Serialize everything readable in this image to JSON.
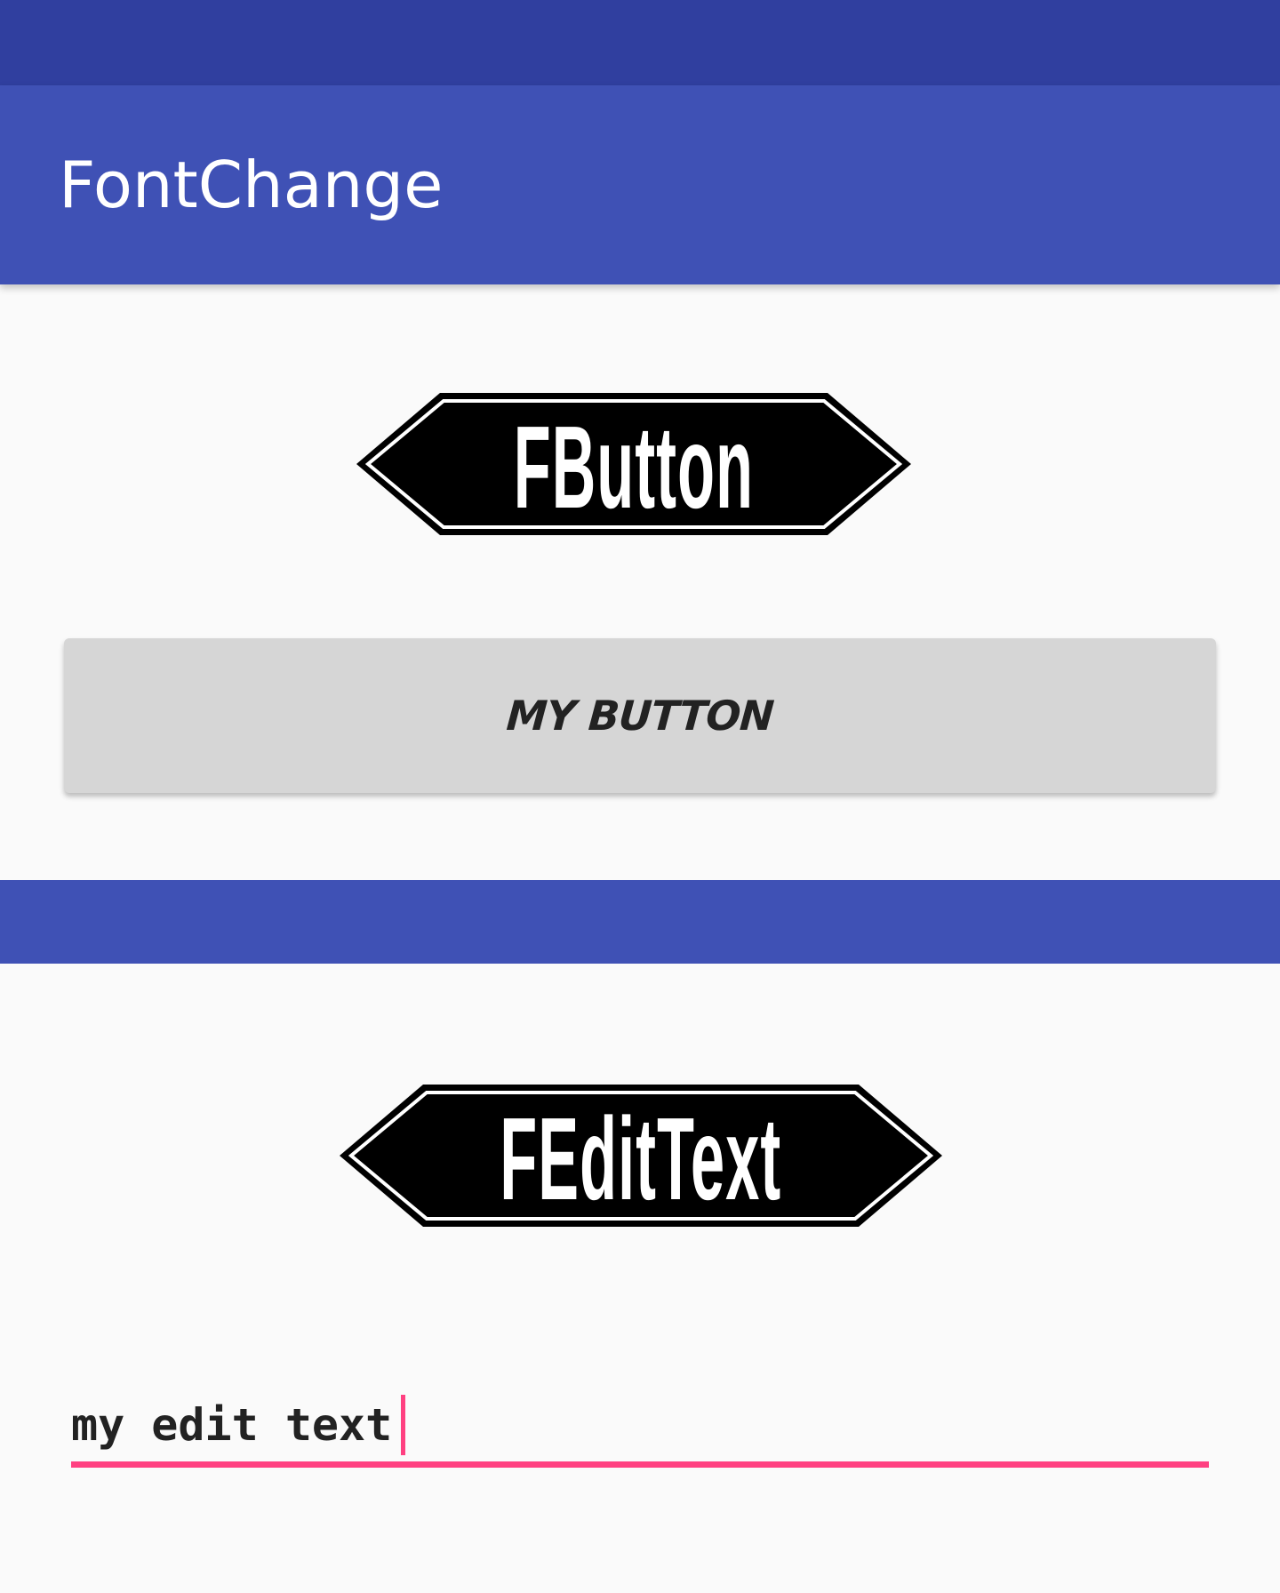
{
  "status_bar": {
    "color": "#303f9f"
  },
  "app_bar": {
    "title": "FontChange",
    "color": "#3f51b5"
  },
  "fbutton_banner": {
    "label": "FButton"
  },
  "my_button": {
    "label": "MY BUTTON"
  },
  "fedittext_banner": {
    "label": "FEditText"
  },
  "edit_text": {
    "value": "my edit text",
    "accent_color": "#ff4081"
  }
}
